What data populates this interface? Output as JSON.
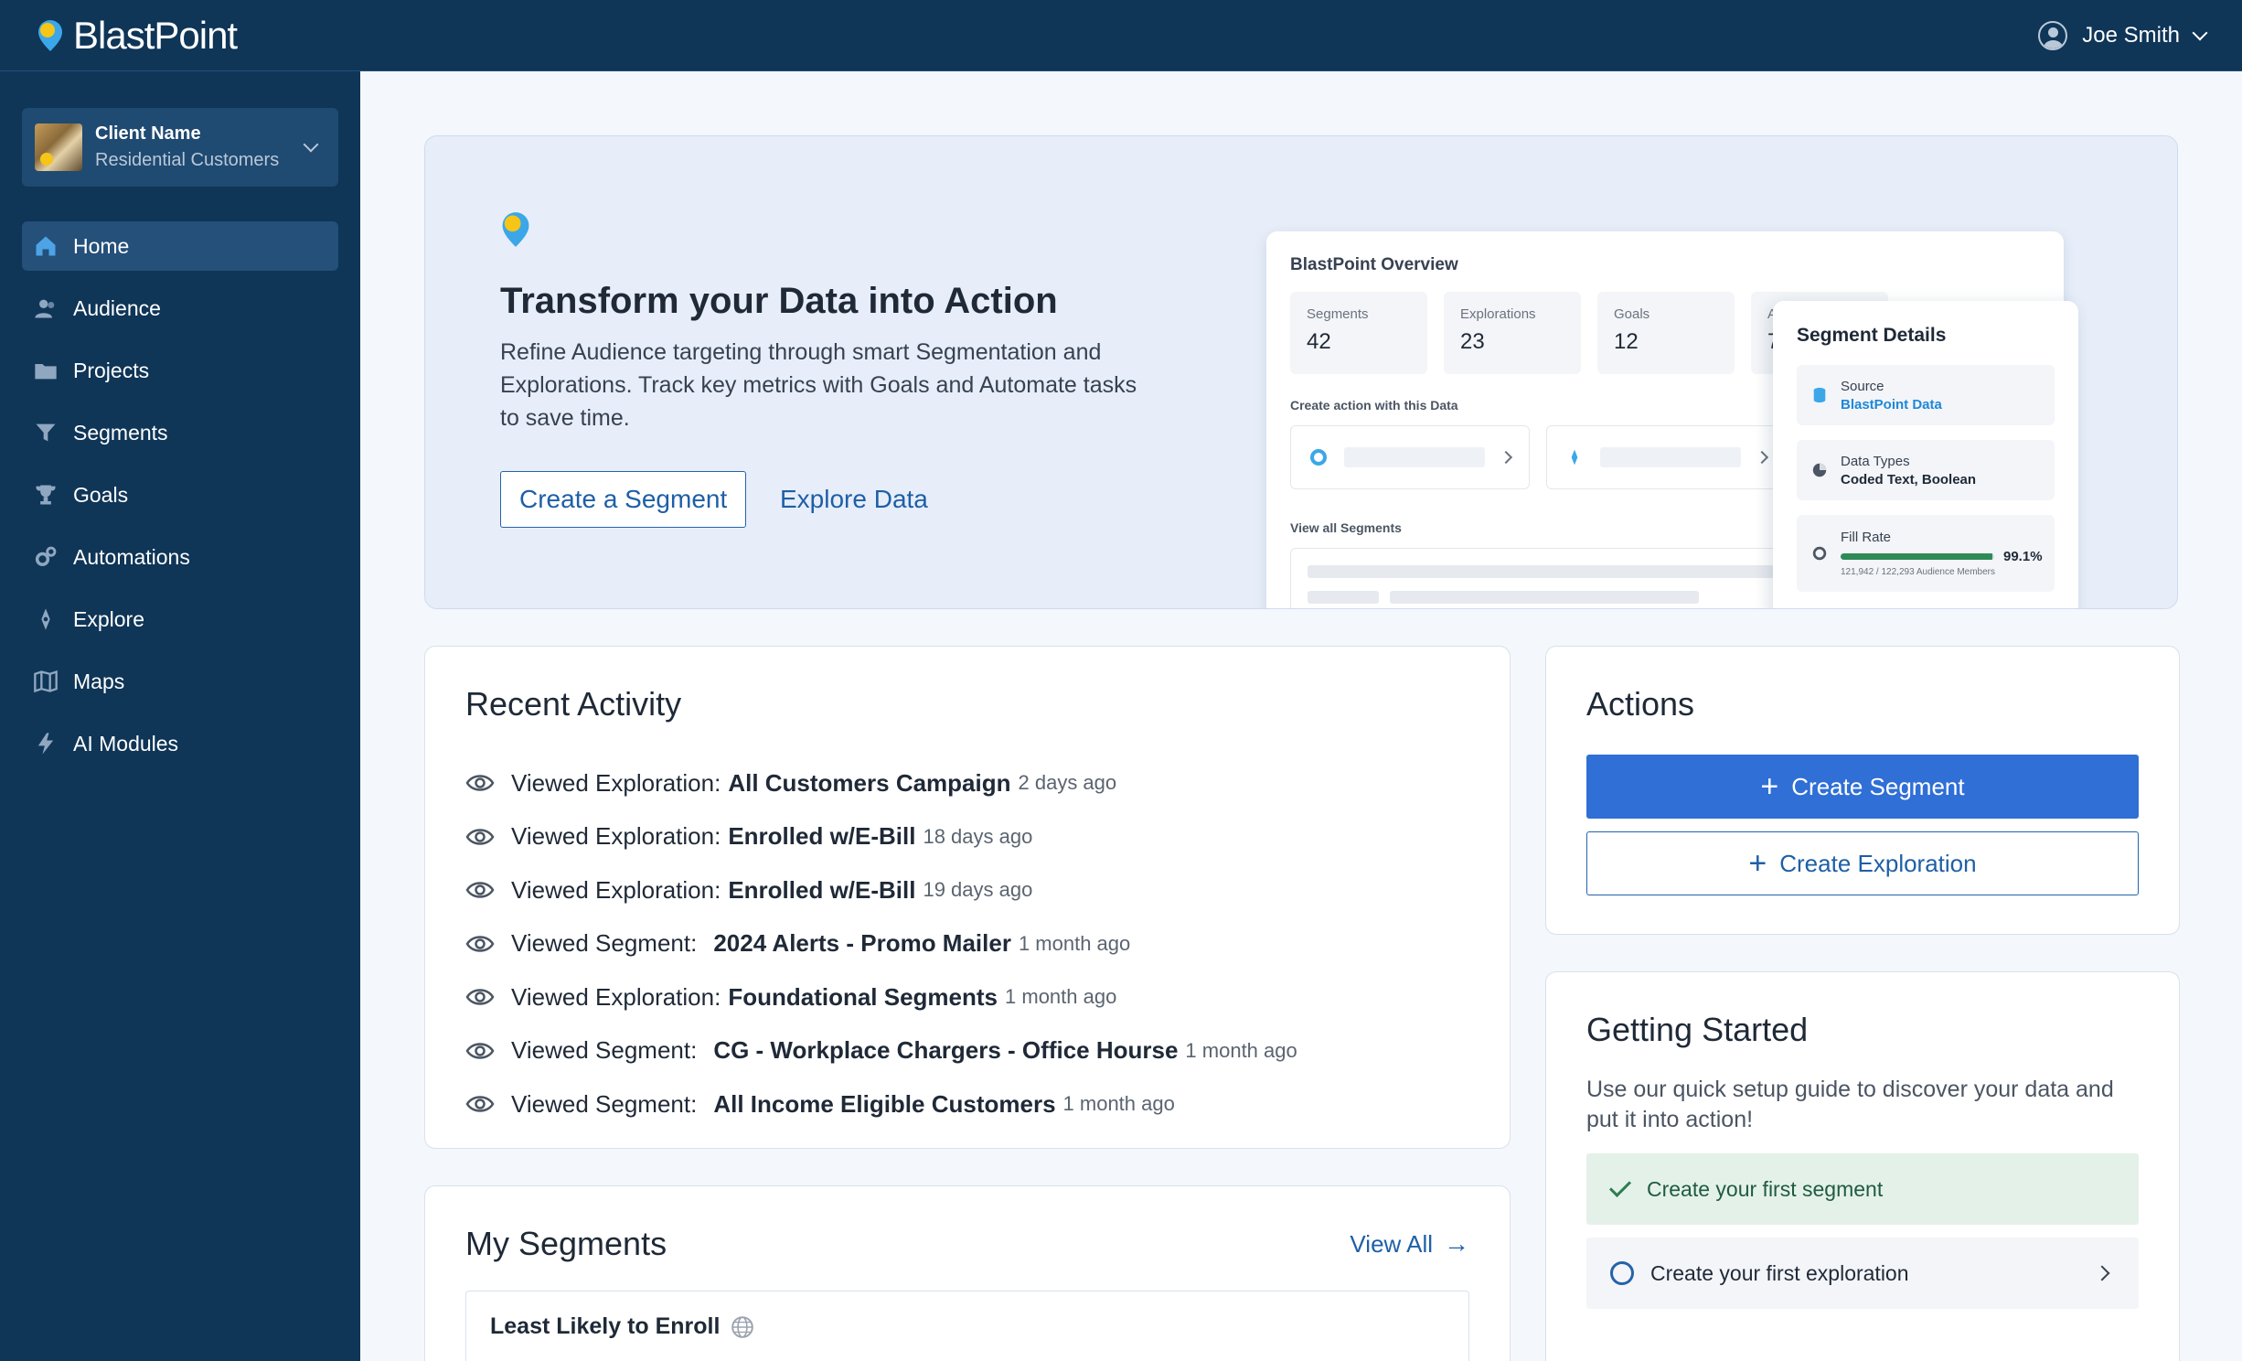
{
  "brand": {
    "name": "BlastPoint",
    "pin_color": "#f5c518",
    "pin_accent": "#3ba7e8"
  },
  "user": {
    "name": "Joe Smith",
    "icon": "user-circle-icon"
  },
  "client": {
    "name": "Client Name",
    "segment": "Residential Customers"
  },
  "nav": [
    {
      "label": "Home",
      "icon": "home-icon",
      "active": true
    },
    {
      "label": "Audience",
      "icon": "users-icon"
    },
    {
      "label": "Projects",
      "icon": "folder-icon"
    },
    {
      "label": "Segments",
      "icon": "filter-icon"
    },
    {
      "label": "Goals",
      "icon": "trophy-icon"
    },
    {
      "label": "Automations",
      "icon": "gears-icon"
    },
    {
      "label": "Explore",
      "icon": "compass-icon"
    },
    {
      "label": "Maps",
      "icon": "map-icon"
    },
    {
      "label": "AI Modules",
      "icon": "bolt-icon"
    }
  ],
  "hero": {
    "title": "Transform your Data into Action",
    "description": "Refine Audience targeting through smart Segmentation and Explorations. Track key metrics with Goals and Automate tasks to save time.",
    "primary_button": "Create a Segment",
    "secondary_link": "Explore Data",
    "overview": {
      "title": "BlastPoint Overview",
      "stats": [
        {
          "label": "Segments",
          "value": "42"
        },
        {
          "label": "Explorations",
          "value": "23"
        },
        {
          "label": "Goals",
          "value": "12"
        },
        {
          "label": "A",
          "value": "7"
        }
      ],
      "create_action_label": "Create action with this Data",
      "view_all_label": "View all Segments"
    },
    "segment_details": {
      "title": "Segment Details",
      "source_label": "Source",
      "source_value": "BlastPoint Data",
      "types_label": "Data Types",
      "types_value": "Coded Text, Boolean",
      "fill_label": "Fill Rate",
      "fill_pct_text": "99.1%",
      "fill_fraction": 0.991,
      "fill_note": "121,942 / 122,293 Audience Members"
    }
  },
  "recent": {
    "title": "Recent Activity",
    "items": [
      {
        "prefix": "Viewed Exploration:",
        "object": "All Customers Campaign",
        "when": "2 days ago"
      },
      {
        "prefix": "Viewed Exploration:",
        "object": "Enrolled w/E-Bill",
        "when": "18 days ago"
      },
      {
        "prefix": "Viewed Exploration:",
        "object": "Enrolled w/E-Bill",
        "when": "19 days ago"
      },
      {
        "prefix": "Viewed Segment:",
        "object": "2024 Alerts - Promo Mailer",
        "when": "1 month ago"
      },
      {
        "prefix": "Viewed Exploration:",
        "object": "Foundational Segments",
        "when": "1 month ago"
      },
      {
        "prefix": "Viewed Segment:",
        "object": "CG - Workplace Chargers - Office Hourse",
        "when": "1 month ago"
      },
      {
        "prefix": "Viewed Segment:",
        "object": "All Income Eligible Customers",
        "when": "1 month ago"
      }
    ]
  },
  "actions": {
    "title": "Actions",
    "create_segment": "Create Segment",
    "create_exploration": "Create Exploration"
  },
  "getting_started": {
    "title": "Getting Started",
    "description": "Use our quick setup guide to discover your data and put it into action!",
    "steps": [
      {
        "label": "Create your first segment",
        "done": true
      },
      {
        "label": "Create your first exploration",
        "done": false
      }
    ]
  },
  "segments": {
    "title": "My Segments",
    "view_all": "View All",
    "items": [
      {
        "name": "Least Likely to Enroll"
      }
    ]
  }
}
